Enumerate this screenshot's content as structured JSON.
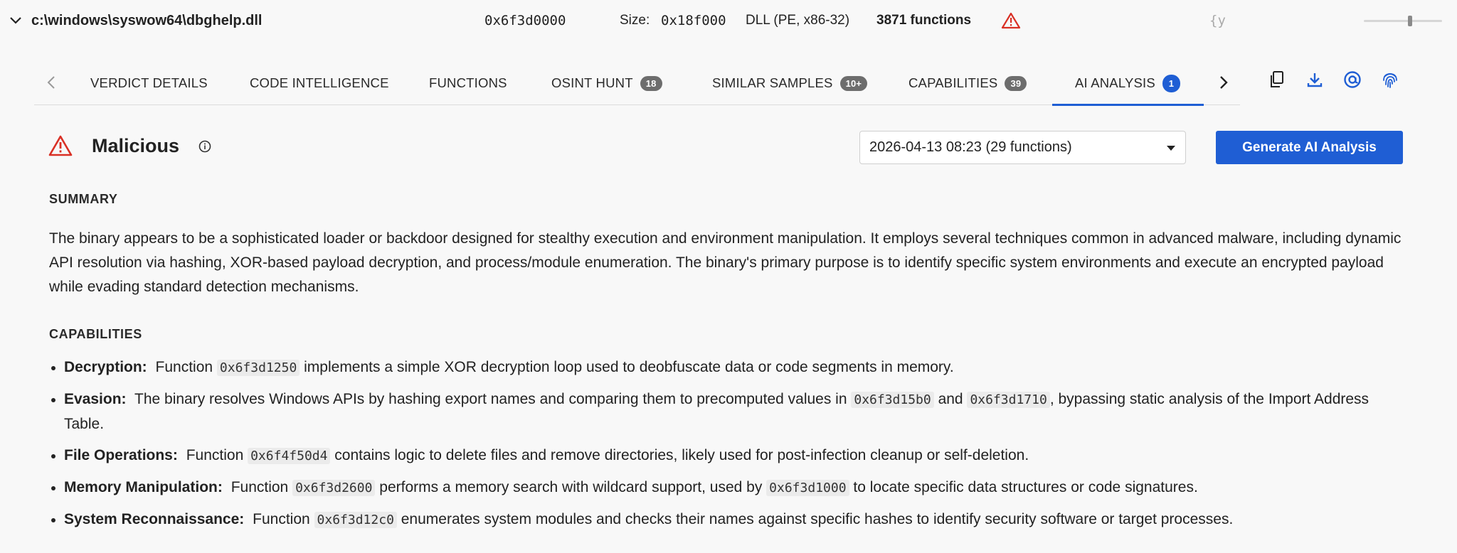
{
  "file": {
    "path": "c:\\windows\\syswow64\\dbghelp.dll",
    "address": "0x6f3d0000",
    "size_label": "Size:",
    "size_value": "0x18f000",
    "type": "DLL (PE, x86-32)",
    "function_count": "3871 functions",
    "json_icon_text": "{y"
  },
  "tabs": {
    "verdict": {
      "label": "VERDICT DETAILS"
    },
    "code": {
      "label": "CODE INTELLIGENCE"
    },
    "functions": {
      "label": "FUNCTIONS"
    },
    "osint": {
      "label": "OSINT HUNT",
      "badge": "18"
    },
    "similar": {
      "label": "SIMILAR SAMPLES",
      "badge": "10+"
    },
    "capabilities": {
      "label": "CAPABILITIES",
      "badge": "39"
    },
    "ai": {
      "label": "AI ANALYSIS",
      "badge": "1"
    }
  },
  "toolbar_icons": [
    "copy-icon",
    "download-icon",
    "at-sign-icon",
    "fingerprint-icon"
  ],
  "verdict": {
    "title": "Malicious",
    "selected_analysis": "2026-04-13 08:23 (29 functions)",
    "generate_button": "Generate AI Analysis"
  },
  "summary": {
    "heading": "SUMMARY",
    "text": "The binary appears to be a sophisticated loader or backdoor designed for stealthy execution and environment manipulation. It employs several techniques common in advanced malware, including dynamic API resolution via hashing, XOR-based payload decryption, and process/module enumeration. The binary's primary purpose is to identify specific system environments and execute an encrypted payload while evading standard detection mechanisms."
  },
  "capabilities": {
    "heading": "CAPABILITIES",
    "items": [
      {
        "name": "Decryption:",
        "t1": "Function ",
        "c1": "0x6f3d1250",
        "t2": " implements a simple XOR decryption loop used to deobfuscate data or code segments in memory."
      },
      {
        "name": "Evasion:",
        "t1": "The binary resolves Windows APIs by hashing export names and comparing them to precomputed values in ",
        "c1": "0x6f3d15b0",
        "t2": " and ",
        "c2": "0x6f3d1710",
        "t3": ", bypassing static analysis of the Import Address Table."
      },
      {
        "name": "File Operations:",
        "t1": "Function ",
        "c1": "0x6f4f50d4",
        "t2": " contains logic to delete files and remove directories, likely used for post-infection cleanup or self-deletion."
      },
      {
        "name": "Memory Manipulation:",
        "t1": "Function ",
        "c1": "0x6f3d2600",
        "t2": " performs a memory search with wildcard support, used by ",
        "c2": "0x6f3d1000",
        "t3": " to locate specific data structures or code signatures."
      },
      {
        "name": "System Reconnaissance:",
        "t1": "Function ",
        "c1": "0x6f3d12c0",
        "t2": " enumerates system modules and checks their names against specific hashes to identify security software or target processes."
      }
    ]
  },
  "colors": {
    "accent": "#1f5ed4",
    "danger": "#d93025",
    "badge": "#6d6d6d"
  }
}
